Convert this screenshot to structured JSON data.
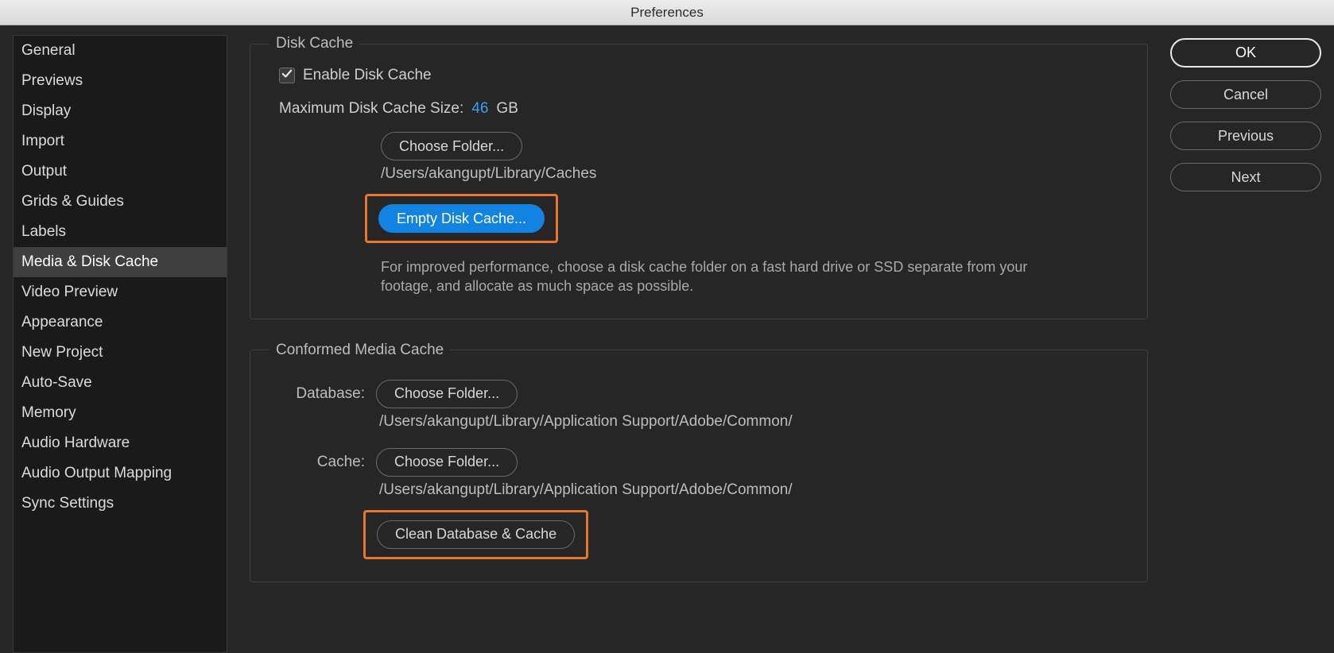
{
  "window": {
    "title": "Preferences"
  },
  "sidebar": {
    "items": [
      {
        "label": "General"
      },
      {
        "label": "Previews"
      },
      {
        "label": "Display"
      },
      {
        "label": "Import"
      },
      {
        "label": "Output"
      },
      {
        "label": "Grids & Guides"
      },
      {
        "label": "Labels"
      },
      {
        "label": "Media & Disk Cache",
        "selected": true
      },
      {
        "label": "Video Preview"
      },
      {
        "label": "Appearance"
      },
      {
        "label": "New Project"
      },
      {
        "label": "Auto-Save"
      },
      {
        "label": "Memory"
      },
      {
        "label": "Audio Hardware"
      },
      {
        "label": "Audio Output Mapping"
      },
      {
        "label": "Sync Settings"
      }
    ]
  },
  "disk_cache": {
    "legend": "Disk Cache",
    "enable_label": "Enable Disk Cache",
    "enable_checked": true,
    "max_size_label": "Maximum Disk Cache Size:",
    "max_size_value": "46",
    "max_size_unit": "GB",
    "choose_folder_label": "Choose Folder...",
    "folder_path": "/Users/akangupt/Library/Caches",
    "empty_label": "Empty Disk Cache...",
    "help_text": "For improved performance, choose a disk cache folder on a fast hard drive or SSD separate from your footage, and allocate as much space as possible."
  },
  "conformed": {
    "legend": "Conformed Media Cache",
    "database_label": "Database:",
    "database_choose_label": "Choose Folder...",
    "database_path": "/Users/akangupt/Library/Application Support/Adobe/Common/",
    "cache_label": "Cache:",
    "cache_choose_label": "Choose Folder...",
    "cache_path": "/Users/akangupt/Library/Application Support/Adobe/Common/",
    "clean_label": "Clean Database & Cache"
  },
  "actions": {
    "ok": "OK",
    "cancel": "Cancel",
    "previous": "Previous",
    "next": "Next"
  }
}
